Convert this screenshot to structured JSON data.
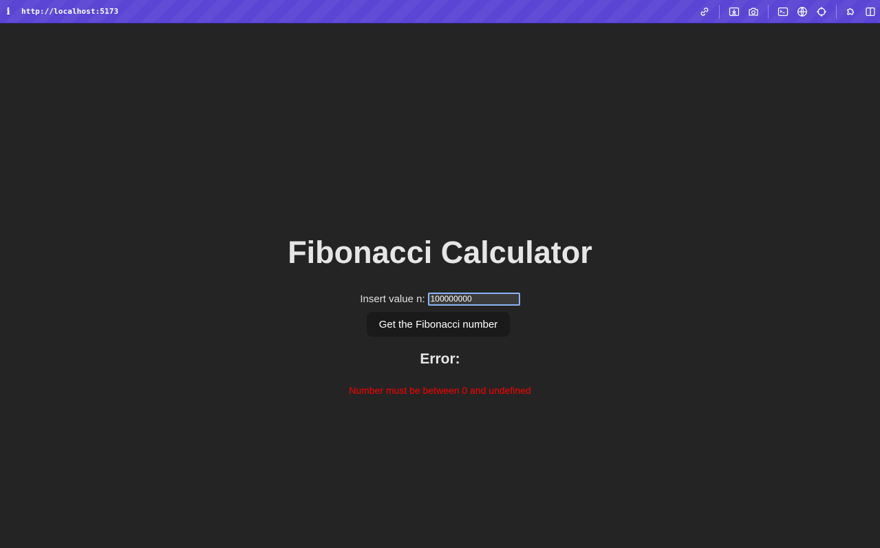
{
  "browser": {
    "info_glyph": "i",
    "url": "http://localhost:5173",
    "tools": [
      "link-icon",
      "download-icon",
      "camera-icon",
      "terminal-icon",
      "globe-icon",
      "crosshair-icon",
      "puzzle-icon",
      "split-view-icon"
    ]
  },
  "app": {
    "title": "Fibonacci Calculator",
    "input_label": "Insert value n:",
    "input_value": "100000000",
    "button_label": "Get the Fibonacci number",
    "error_heading": "Error:",
    "error_message": "Number must be between 0 and undefined"
  },
  "colors": {
    "background": "#242424",
    "toolbar": "#5b45d4",
    "error": "#ff0000",
    "button_bg": "#1a1a1a",
    "input_focus_border": "#8ab4f8"
  }
}
